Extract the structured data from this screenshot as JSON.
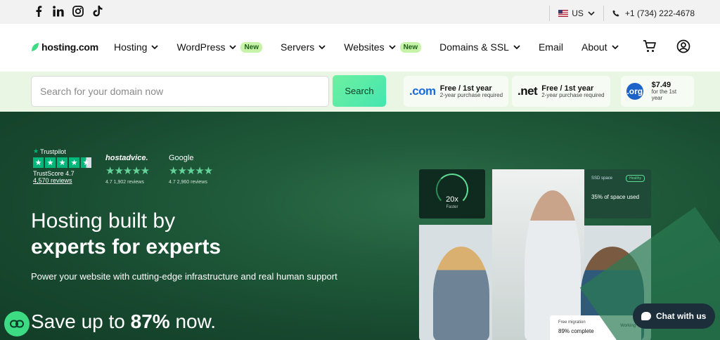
{
  "topbar": {
    "social_icons": [
      "facebook-icon",
      "linkedin-icon",
      "instagram-icon",
      "tiktok-icon"
    ],
    "locale": "US",
    "phone": "+1 (734) 222-4678"
  },
  "nav": {
    "logo": "hosting.com",
    "items": [
      {
        "label": "Hosting",
        "chevron": true,
        "badge": ""
      },
      {
        "label": "WordPress",
        "chevron": true,
        "badge": "New"
      },
      {
        "label": "Servers",
        "chevron": true,
        "badge": ""
      },
      {
        "label": "Websites",
        "chevron": true,
        "badge": "New"
      },
      {
        "label": "Domains & SSL",
        "chevron": true,
        "badge": ""
      },
      {
        "label": "Email",
        "chevron": false,
        "badge": ""
      },
      {
        "label": "About",
        "chevron": true,
        "badge": ""
      }
    ],
    "icons": [
      "cart-icon",
      "account-icon"
    ]
  },
  "domain_search": {
    "placeholder": "Search for your domain now",
    "button": "Search",
    "offers": [
      {
        "tld": ".com",
        "line1": "Free / 1st year",
        "line2": "2-year purchase required"
      },
      {
        "tld": ".net",
        "line1": "Free / 1st year",
        "line2": "2-year purchase required"
      },
      {
        "tld": ".org",
        "line1": "$7.49",
        "line2": "for the 1st year"
      }
    ]
  },
  "ratings": {
    "trustpilot": {
      "label": "Trustpilot",
      "score": "TrustScore 4.7",
      "reviews": "4,570 reviews"
    },
    "hostadvice": {
      "label": "hostadvice.",
      "meta": "4.7 1,902 reviews"
    },
    "google": {
      "label": "Google",
      "meta": "4.7 2,960 reviews"
    }
  },
  "hero": {
    "title_line1": "Hosting built by",
    "title_line2": "experts for experts",
    "subtitle": "Power your website with cutting-edge infrastructure and real human support",
    "save_prefix": "Save up to ",
    "save_value": "87%",
    "save_suffix": " now."
  },
  "cards": {
    "speed": {
      "value": "20x",
      "label": "Faster"
    },
    "ssd": {
      "title": "SSD space",
      "pill": "Healthy",
      "value": "35% of space used"
    },
    "migration": {
      "title": "Free migration",
      "value": "89% complete",
      "status": "Working"
    }
  },
  "chat": {
    "label": "Chat with us"
  },
  "colors": {
    "accent": "#3ddc84",
    "hero_bg": "#1f5a3a",
    "band_bg": "#e9f6e3"
  }
}
